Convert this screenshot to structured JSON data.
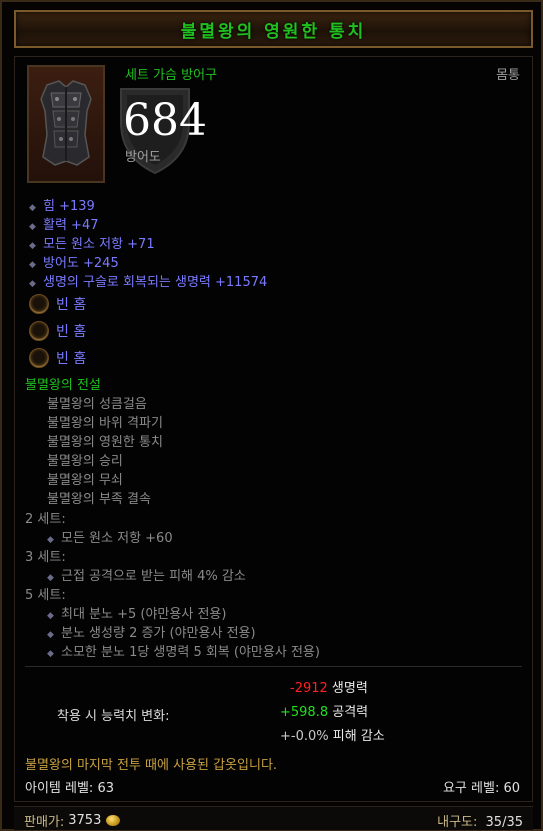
{
  "item": {
    "name": "불멸왕의 영원한 통치",
    "set_type": "세트 가슴 방어구",
    "slot": "몸통",
    "armor_value": "684",
    "armor_label": "방어도"
  },
  "stats": [
    "힘 +139",
    "활력 +47",
    "모든 원소 저항 +71",
    "방어도 +245",
    "생명의 구슬로 회복되는 생명력 +11574"
  ],
  "sockets": [
    "빈 홈",
    "빈 홈",
    "빈 홈"
  ],
  "set": {
    "name": "불멸왕의 전설",
    "pieces": [
      "불멸왕의 성큼걸음",
      "불멸왕의 바위 격파기",
      "불멸왕의 영원한 통치",
      "불멸왕의 승리",
      "불멸왕의 무쇠",
      "불멸왕의 부족 결속"
    ],
    "bonuses": [
      {
        "header": "2 세트:",
        "effects": [
          "모든 원소 저항 +60"
        ]
      },
      {
        "header": "3 세트:",
        "effects": [
          "근접 공격으로 받는 피해 4% 감소"
        ]
      },
      {
        "header": "5 세트:",
        "effects": [
          "최대 분노 +5 (야만용사 전용)",
          "분노 생성량 2 증가 (야만용사 전용)",
          "소모한 분노 1당 생명력 5 회복 (야만용사 전용)"
        ]
      }
    ]
  },
  "stat_changes": {
    "label": "착용 시 능력치 변화:",
    "rows": [
      {
        "value": "-2912",
        "label": "생명력",
        "kind": "negative"
      },
      {
        "value": "+598.8",
        "label": "공격력",
        "kind": "positive"
      },
      {
        "value": "+-0.0%",
        "label": "피해 감소",
        "kind": "neutral"
      }
    ]
  },
  "flavor_text": "불멸왕의 마지막 전투 때에 사용된 갑옷입니다.",
  "item_level": "아이템 레벨: 63",
  "required_level": "요구 레벨: 60",
  "footer": {
    "price_label": "판매가:",
    "price_value": "3753",
    "durability_label": "내구도:",
    "durability_value": "35/35"
  },
  "colors": {
    "set_green": "#1fc01f",
    "magic_blue": "#7a7aff",
    "flavor_gold": "#c8a040",
    "negative_red": "#ff2020",
    "positive_green": "#20e020"
  },
  "icons": {
    "item": "chest-armor-icon",
    "shield": "armor-shield-icon",
    "stat_bullet": "diamond-bullet-icon",
    "socket": "empty-socket-icon",
    "currency": "gold-coin-icon"
  }
}
